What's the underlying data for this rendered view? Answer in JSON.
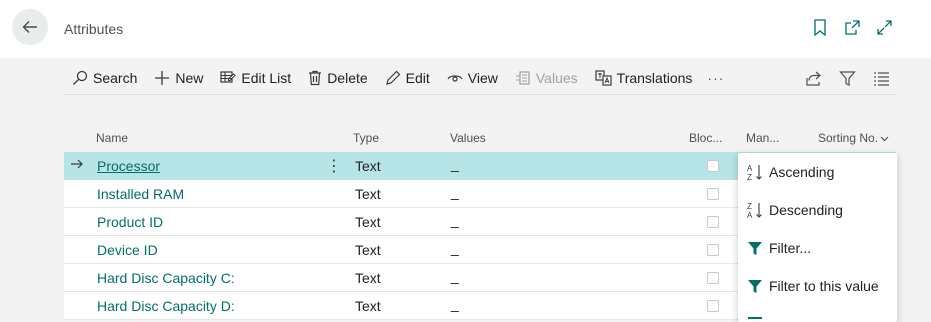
{
  "page": {
    "title": "Attributes"
  },
  "actions": {
    "search": "Search",
    "new": "New",
    "edit_list": "Edit List",
    "delete": "Delete",
    "edit": "Edit",
    "view": "View",
    "values": "Values",
    "translations": "Translations",
    "more": "···"
  },
  "columns": {
    "name": "Name",
    "type": "Type",
    "values": "Values",
    "blocked": "Bloc...",
    "mandatory": "Man...",
    "sorting": "Sorting No."
  },
  "rows": [
    {
      "name": "Processor",
      "type": "Text",
      "values": "_"
    },
    {
      "name": "Installed RAM",
      "type": "Text",
      "values": "_"
    },
    {
      "name": "Product ID",
      "type": "Text",
      "values": "_"
    },
    {
      "name": "Device ID",
      "type": "Text",
      "values": "_"
    },
    {
      "name": "Hard Disc Capacity C:",
      "type": "Text",
      "values": "_"
    },
    {
      "name": "Hard Disc Capacity D:",
      "type": "Text",
      "values": "_"
    }
  ],
  "sort_menu": {
    "ascending": "Ascending",
    "descending": "Descending",
    "filter": "Filter...",
    "filter_value": "Filter to this value"
  },
  "colors": {
    "accent": "#00706b",
    "selected_row": "#b7e4e6",
    "background": "#f3f3f3"
  }
}
